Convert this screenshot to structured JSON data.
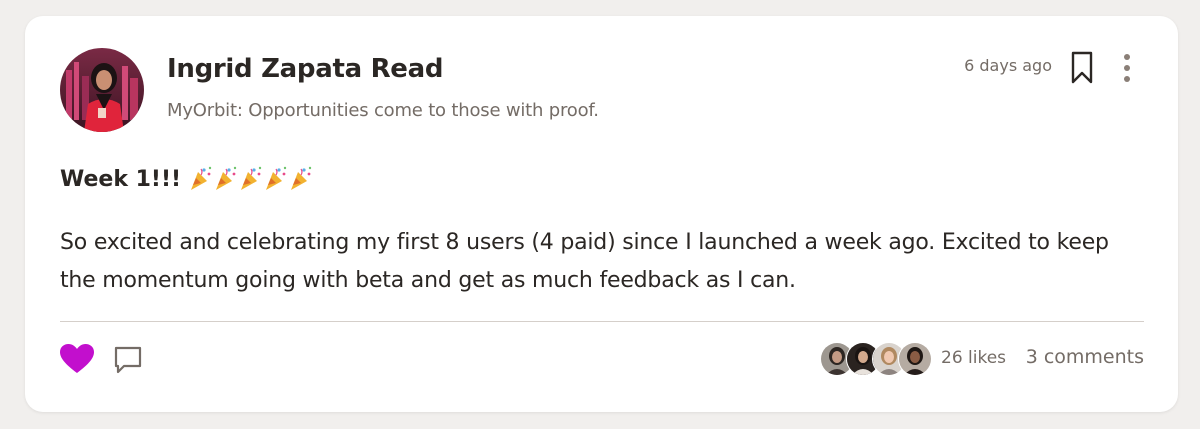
{
  "post": {
    "author": {
      "name": "Ingrid Zapata Read",
      "headline": "MyOrbit: Opportunities come to those with proof."
    },
    "time_ago": "6 days ago",
    "title": "Week 1!!!",
    "title_emoji": "party-popper-icon",
    "title_emoji_count": 5,
    "body": "So excited and celebrating my first 8 users (4 paid) since I launched a week ago. Excited to keep the momentum going with beta and get as much feedback as I can.",
    "reactions": {
      "liked": true,
      "likes_label": "26 likes",
      "comments_label": "3 comments"
    }
  },
  "colors": {
    "background": "#f1efed",
    "card": "#ffffff",
    "text_primary": "#2b2724",
    "text_secondary": "#746c66",
    "accent_like": "#c20fcd",
    "divider": "#d5cfca"
  },
  "icons": {
    "bookmark": "bookmark-icon",
    "more": "more-vertical-icon",
    "like": "heart-icon",
    "comment": "comment-icon"
  }
}
